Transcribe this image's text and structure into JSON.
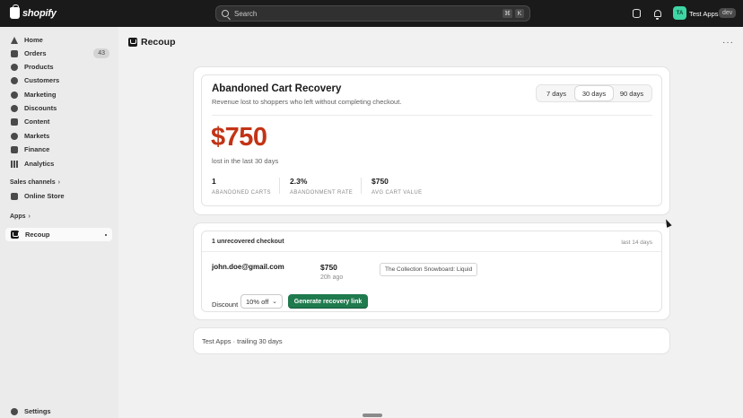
{
  "topbar": {
    "brand": "shopify",
    "search_placeholder": "Search",
    "shortcut_keys": [
      "⌘",
      "K"
    ],
    "avatar_initials": "TA",
    "store_name": "Test Apps",
    "env_badge": "dev"
  },
  "sidebar": {
    "items": [
      {
        "label": "Home",
        "icon": "home-icon"
      },
      {
        "label": "Orders",
        "icon": "orders-icon",
        "badge": "43"
      },
      {
        "label": "Products",
        "icon": "tag-icon"
      },
      {
        "label": "Customers",
        "icon": "person-icon"
      },
      {
        "label": "Marketing",
        "icon": "target-icon"
      },
      {
        "label": "Discounts",
        "icon": "discount-icon"
      },
      {
        "label": "Content",
        "icon": "content-icon"
      },
      {
        "label": "Markets",
        "icon": "globe-icon"
      },
      {
        "label": "Finance",
        "icon": "bank-icon"
      },
      {
        "label": "Analytics",
        "icon": "chart-icon"
      }
    ],
    "sales_channels_label": "Sales channels",
    "online_store_label": "Online Store",
    "apps_label": "Apps",
    "recoup_label": "Recoup",
    "settings_label": "Settings"
  },
  "page": {
    "title": "Recoup"
  },
  "summary_card": {
    "title": "Abandoned Cart Recovery",
    "subtitle": "Revenue lost to shoppers who left without completing checkout.",
    "ranges": [
      "7 days",
      "30 days",
      "90 days"
    ],
    "selected_range": "30 days",
    "amount": "$750",
    "amount_note": "lost in the last 30 days",
    "stats": [
      {
        "value": "1",
        "label": "ABANDONED CARTS"
      },
      {
        "value": "2.3%",
        "label": "ABANDONMENT RATE"
      },
      {
        "value": "$750",
        "label": "AVG CART VALUE"
      }
    ]
  },
  "checkout_card": {
    "header": "1 unrecovered checkout",
    "header_right": "last 14 days",
    "email": "john.doe@gmail.com",
    "value": "$750",
    "time_ago": "20h ago",
    "product": "The Collection Snowboard: Liquid",
    "discount_label": "Discount",
    "discount_value": "10% off",
    "cta": "Generate recovery link"
  },
  "footer": {
    "text": "Test Apps · trailing 30 days"
  },
  "colors": {
    "topbar": "#1a1a1a",
    "loss_amount": "#c23416",
    "primary_button": "#1f7a4d"
  }
}
